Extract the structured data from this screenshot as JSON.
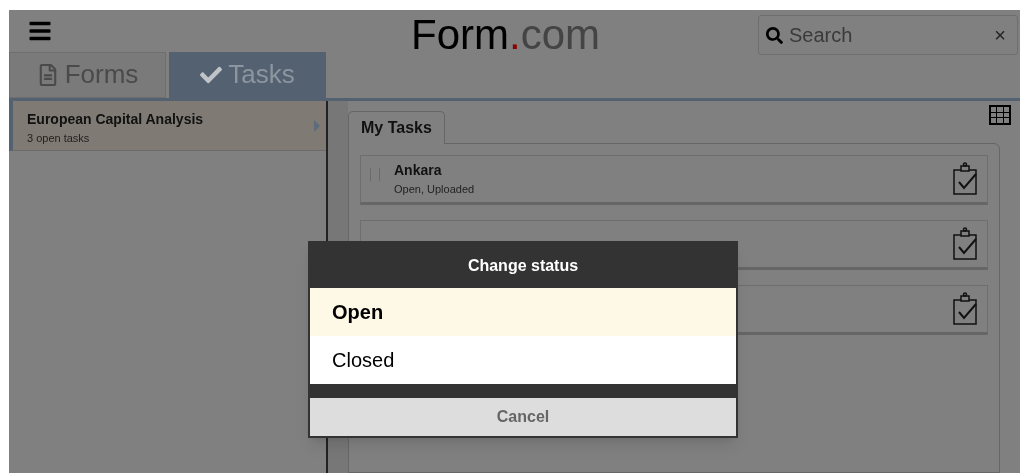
{
  "header": {
    "logo": {
      "name": "Form",
      "dot": ".",
      "domain": "com"
    },
    "search": {
      "placeholder": "Search",
      "clear": "×"
    }
  },
  "tabs": [
    {
      "label": "Forms",
      "kind": "forms",
      "selected": false
    },
    {
      "label": "Tasks",
      "kind": "tasks",
      "selected": true
    }
  ],
  "sidebar": {
    "items": [
      {
        "title": "European Capital Analysis",
        "subtitle": "3 open tasks",
        "selected": true
      }
    ]
  },
  "content": {
    "tabs": [
      {
        "label": "My Tasks",
        "selected": true
      }
    ],
    "tasks": [
      {
        "kind": "visible",
        "title": "Ankara",
        "status": "Open, Uploaded",
        "checked": false
      },
      {
        "kind": "covered"
      },
      {
        "kind": "covered"
      }
    ]
  },
  "dialog": {
    "title": "Change status",
    "options": [
      {
        "label": "Open",
        "selected": true
      },
      {
        "label": "Closed",
        "selected": false
      }
    ],
    "cancel": "Cancel"
  }
}
